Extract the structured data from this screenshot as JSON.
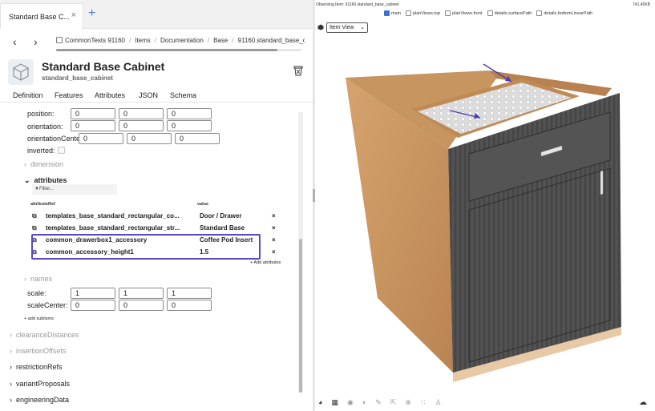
{
  "tab": {
    "title": "Standard Base C...",
    "close": "×",
    "new": "+"
  },
  "nav": {
    "back": "‹",
    "forward": "›"
  },
  "breadcrumb": {
    "items": [
      "CommonTests 91160",
      "Items",
      "Documentation",
      "Base",
      "91160.standard_base_c"
    ],
    "separator": "/"
  },
  "header": {
    "title": "Standard Base Cabinet",
    "subtitle": "standard_base_cabinet"
  },
  "prop_tabs": [
    "Definition",
    "Features",
    "Attributes",
    "JSON",
    "Schema"
  ],
  "props": {
    "position": {
      "label": "position:",
      "values": [
        "0",
        "0",
        "0"
      ]
    },
    "orientation": {
      "label": "orientation:",
      "values": [
        "0",
        "0",
        "0"
      ]
    },
    "orientationCenter": {
      "label": "orientationCente",
      "values": [
        "0",
        "0",
        "0"
      ]
    },
    "inverted": {
      "label": "inverted:"
    },
    "dimension": "dimension",
    "attributes": "attributes",
    "names": "names",
    "scale": {
      "label": "scale:",
      "values": [
        "1",
        "1",
        "1"
      ]
    },
    "scaleCenter": {
      "label": "scaleCenter:",
      "values": [
        "0",
        "0",
        "0"
      ]
    },
    "add_sublisms": "+ add sublisms"
  },
  "attributes": {
    "filter": "Filter...",
    "col_ref": "attributeRef",
    "col_value": "value",
    "rows": [
      {
        "ref": "templates_base_standard_rectangular_co...",
        "value": "Door / Drawer"
      },
      {
        "ref": "templates_base_standard_rectangular_str...",
        "value": "Standard Base"
      },
      {
        "ref": "common_drawerbox1_accessory",
        "value": "Coffee Pod Insert"
      },
      {
        "ref": "common_accessory_height1",
        "value": "1.5"
      }
    ],
    "remove": "×",
    "add": "+ Add attributes"
  },
  "sections": [
    "clearanceDistances",
    "insertionOffsets",
    "restrictionRefs",
    "variantProposals",
    "engineeringData"
  ],
  "viewer": {
    "observing": "Observing Item: 91160.standard_base_cabinet",
    "memory": "741.45KB",
    "layers": [
      {
        "label": "main",
        "checked": true
      },
      {
        "label": "planViews.top",
        "checked": false
      },
      {
        "label": "planViews.front",
        "checked": false
      },
      {
        "label": "details.surfacePath",
        "checked": false
      },
      {
        "label": "details.bottomLinearPath",
        "checked": false
      }
    ],
    "view_mode": "Item View"
  },
  "colors": {
    "accent": "#5a48c4",
    "wood": "#c8935d",
    "cabinet_front": "#4b4b4b"
  }
}
